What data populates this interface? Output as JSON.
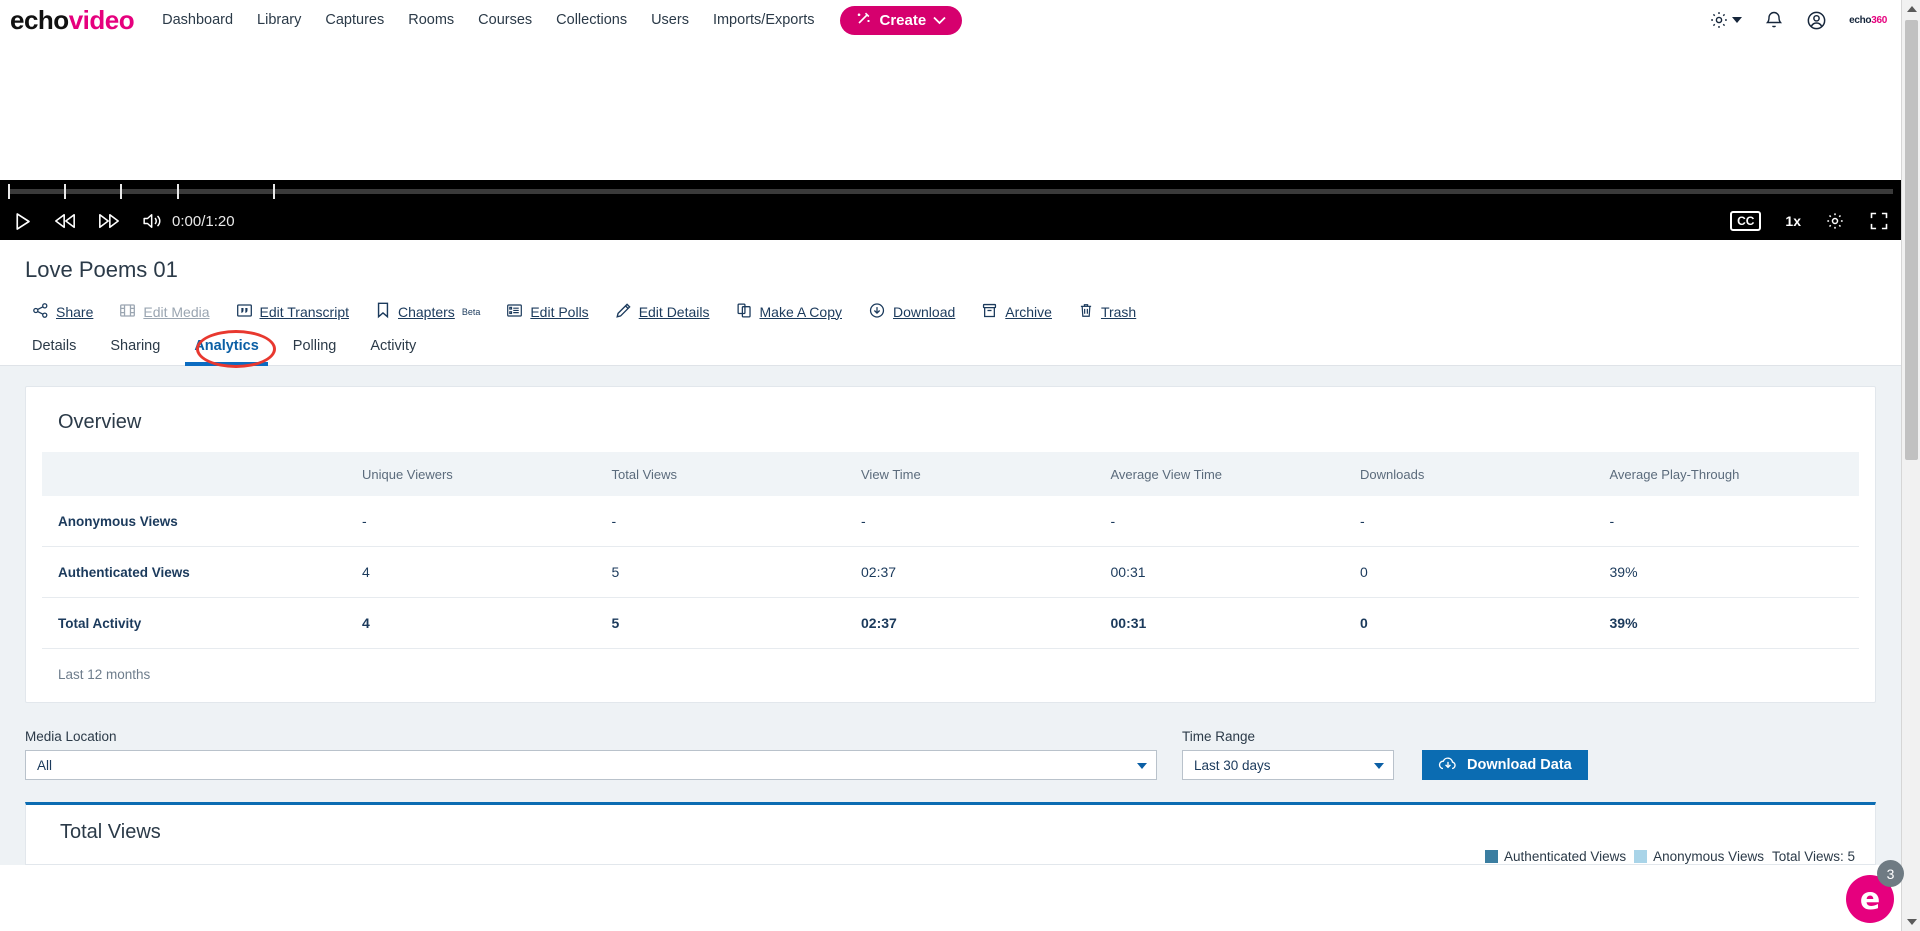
{
  "header": {
    "brand_echo": "echo",
    "brand_video": "video",
    "nav_items": [
      {
        "label": "Dashboard"
      },
      {
        "label": "Library"
      },
      {
        "label": "Captures"
      },
      {
        "label": "Rooms"
      },
      {
        "label": "Courses"
      },
      {
        "label": "Collections"
      },
      {
        "label": "Users"
      },
      {
        "label": "Imports/Exports"
      }
    ],
    "create_label": "Create",
    "org_logo_text": "echo",
    "org_logo_num": "360",
    "accent_pink": "#d6006e",
    "icons": [
      "gear-icon",
      "bell-icon",
      "account-icon"
    ]
  },
  "player": {
    "time_display": "0:00/1:20",
    "cc_label": "CC",
    "speed_label": "1x",
    "controls": [
      "play-icon",
      "rewind-icon",
      "fast-forward-icon",
      "volume-icon"
    ],
    "right_controls": [
      "cc-button",
      "playback-speed",
      "settings-icon",
      "fullscreen-icon"
    ]
  },
  "media": {
    "title": "Love Poems 01",
    "actions": [
      {
        "label": "Share",
        "icon": "share-icon",
        "disabled": false
      },
      {
        "label": "Edit Media",
        "icon": "film-icon",
        "disabled": true
      },
      {
        "label": "Edit Transcript",
        "icon": "quote-icon",
        "disabled": false
      },
      {
        "label": "Chapters",
        "icon": "bookmark-icon",
        "disabled": false,
        "sup": "Beta"
      },
      {
        "label": "Edit Polls",
        "icon": "list-icon",
        "disabled": false
      },
      {
        "label": "Edit Details",
        "icon": "pencil-icon",
        "disabled": false
      },
      {
        "label": "Make A Copy",
        "icon": "copy-icon",
        "disabled": false
      },
      {
        "label": "Download",
        "icon": "download-cloud-icon",
        "disabled": false
      },
      {
        "label": "Archive",
        "icon": "archive-icon",
        "disabled": false
      },
      {
        "label": "Trash",
        "icon": "trash-icon",
        "disabled": false
      }
    ],
    "tabs": [
      {
        "label": "Details",
        "active": false
      },
      {
        "label": "Sharing",
        "active": false
      },
      {
        "label": "Analytics",
        "active": true
      },
      {
        "label": "Polling",
        "active": false
      },
      {
        "label": "Activity",
        "active": false
      }
    ],
    "annotation_color": "#e8382f"
  },
  "overview": {
    "title": "Overview",
    "columns": [
      "",
      "Unique Viewers",
      "Total Views",
      "View Time",
      "Average View Time",
      "Downloads",
      "Average Play-Through"
    ],
    "rows": [
      {
        "label": "Anonymous Views",
        "values": [
          "-",
          "-",
          "-",
          "-",
          "-",
          "-"
        ],
        "bold": false
      },
      {
        "label": "Authenticated Views",
        "values": [
          "4",
          "5",
          "02:37",
          "00:31",
          "0",
          "39%"
        ],
        "bold": false
      },
      {
        "label": "Total Activity",
        "values": [
          "4",
          "5",
          "02:37",
          "00:31",
          "0",
          "39%"
        ],
        "bold": true
      }
    ],
    "footer": "Last 12 months"
  },
  "filters": {
    "media_location_label": "Media Location",
    "media_location_value": "All",
    "time_range_label": "Time Range",
    "time_range_value": "Last 30 days",
    "download_label": "Download Data"
  },
  "total_views": {
    "title": "Total Views",
    "legend": [
      {
        "label": "Authenticated Views",
        "color": "#3b7ea1"
      },
      {
        "label": "Anonymous Views",
        "color": "#a9d4e8"
      }
    ],
    "total_label": "Total Views: 5"
  },
  "chat": {
    "badge_count": "3",
    "glyph": "e"
  }
}
